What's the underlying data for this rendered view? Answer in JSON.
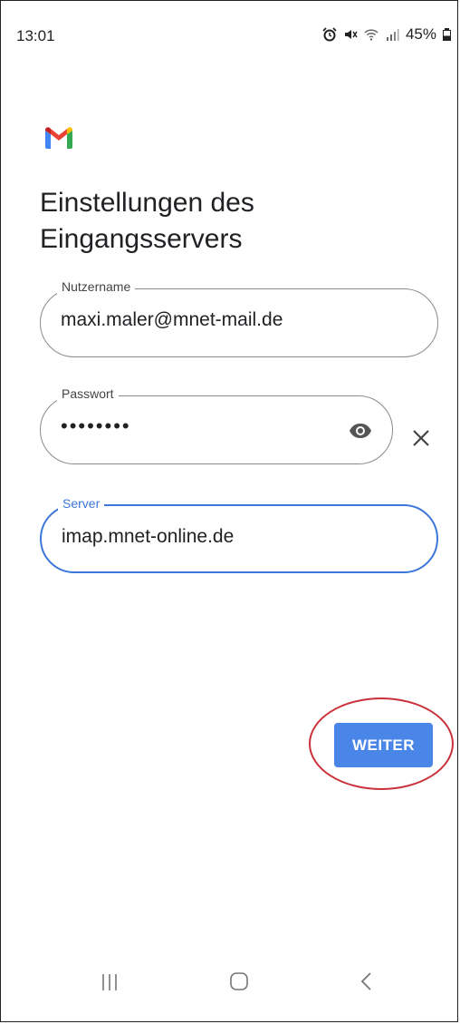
{
  "status_bar": {
    "time": "13:01",
    "battery_percent": "45%",
    "icons": [
      "alarm-icon",
      "mute-icon",
      "wifi-icon",
      "signal-icon",
      "battery-icon"
    ]
  },
  "app": {
    "logo": "gmail-logo"
  },
  "page": {
    "title": "Einstellungen des Eingangsservers"
  },
  "form": {
    "username": {
      "label": "Nutzername",
      "value": "maxi.maler@mnet-mail.de"
    },
    "password": {
      "label": "Passwort",
      "value": "••••••••"
    },
    "server": {
      "label": "Server",
      "value": "imap.mnet-online.de"
    }
  },
  "actions": {
    "next_label": "WEITER"
  },
  "colors": {
    "accent": "#4a86e8",
    "focus": "#3b77d8",
    "highlight": "#c9323a"
  },
  "nav_bar": {
    "items": [
      "recent-apps-icon",
      "home-icon",
      "back-icon"
    ]
  }
}
